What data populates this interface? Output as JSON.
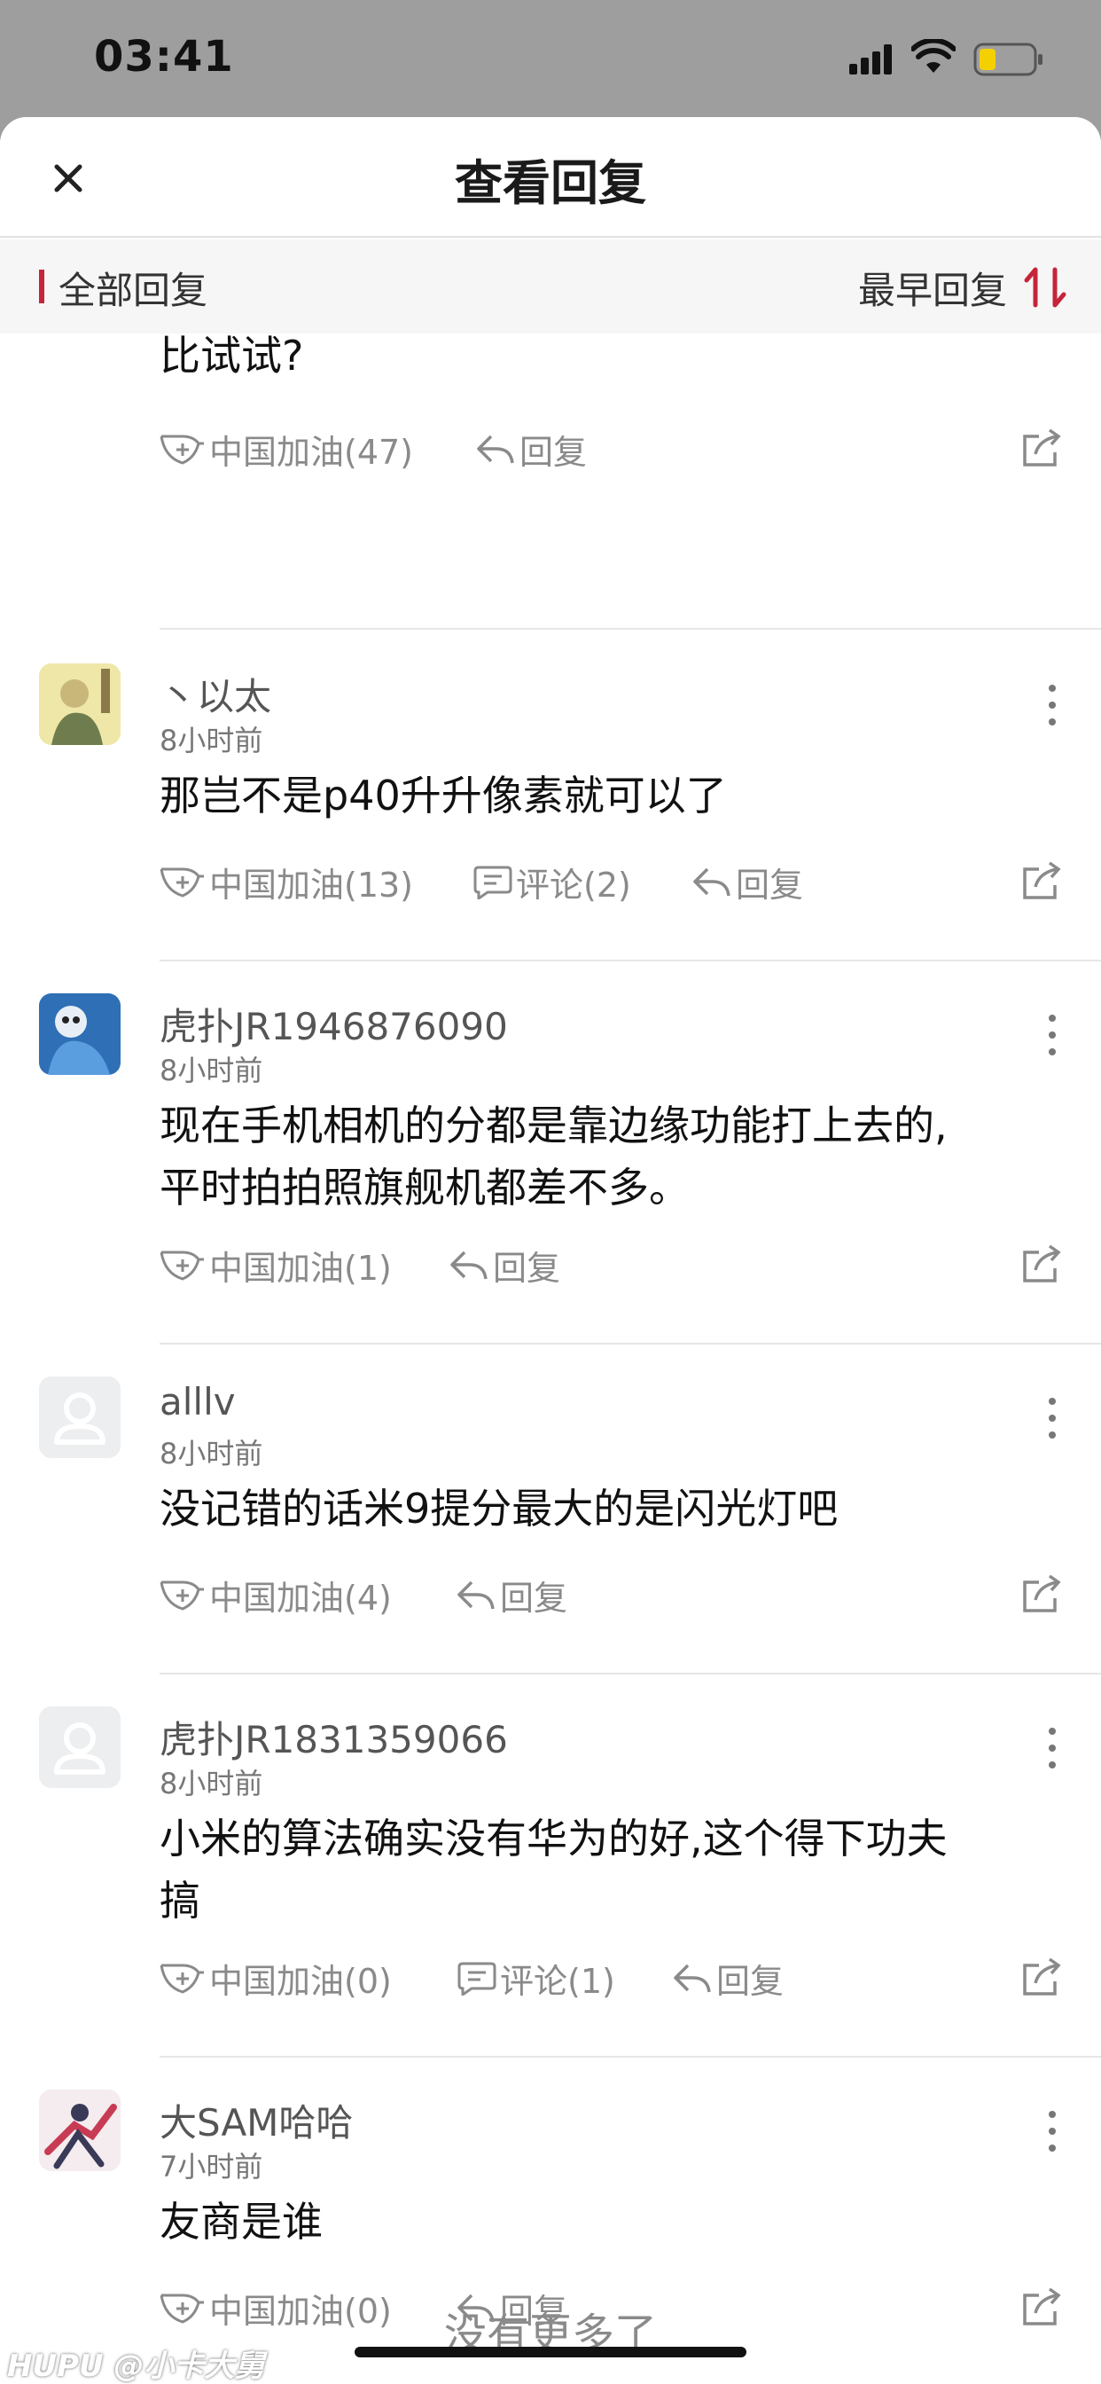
{
  "status_bar": {
    "time": "03:41"
  },
  "header": {
    "title": "查看回复"
  },
  "filter": {
    "all_label": "全部回复",
    "sort_label": "最早回复"
  },
  "partial_item": {
    "content": "比试试?",
    "like_label": "中国加油(47)",
    "reply_label": "回复"
  },
  "replies": [
    {
      "username": "丶以太",
      "time": "8小时前",
      "content": "那岂不是p40升升像素就可以了",
      "like_label": "中国加油(13)",
      "comment_label": "评论(2)",
      "reply_label": "回复"
    },
    {
      "username": "虎扑JR1946876090",
      "time": "8小时前",
      "content_line1": "现在手机相机的分都是靠边缘功能打上去的,",
      "content_line2": "平时拍拍照旗舰机都差不多。",
      "like_label": "中国加油(1)",
      "reply_label": "回复"
    },
    {
      "username": "alllv",
      "time": "8小时前",
      "content": "没记错的话米9提分最大的是闪光灯吧",
      "like_label": "中国加油(4)",
      "reply_label": "回复"
    },
    {
      "username": "虎扑JR1831359066",
      "time": "8小时前",
      "content_line1": "小米的算法确实没有华为的好,这个得下功夫",
      "content_line2": "搞",
      "like_label": "中国加油(0)",
      "comment_label": "评论(1)",
      "reply_label": "回复"
    },
    {
      "username": "大SAM哈哈",
      "time": "7小时前",
      "content": "友商是谁",
      "like_label": "中国加油(0)",
      "reply_label": "回复"
    }
  ],
  "footer": {
    "no_more": "没有更多了",
    "watermark": "HUPU @小卡大舅"
  },
  "colors": {
    "accent": "#c5243a",
    "muted": "#8a8a8a"
  },
  "icons": [
    "signal-icon",
    "wifi-icon",
    "battery-icon",
    "close-icon",
    "sort-icon",
    "like-icon",
    "comment-icon",
    "reply-icon",
    "share-icon",
    "more-icon",
    "avatar-placeholder-icon"
  ]
}
